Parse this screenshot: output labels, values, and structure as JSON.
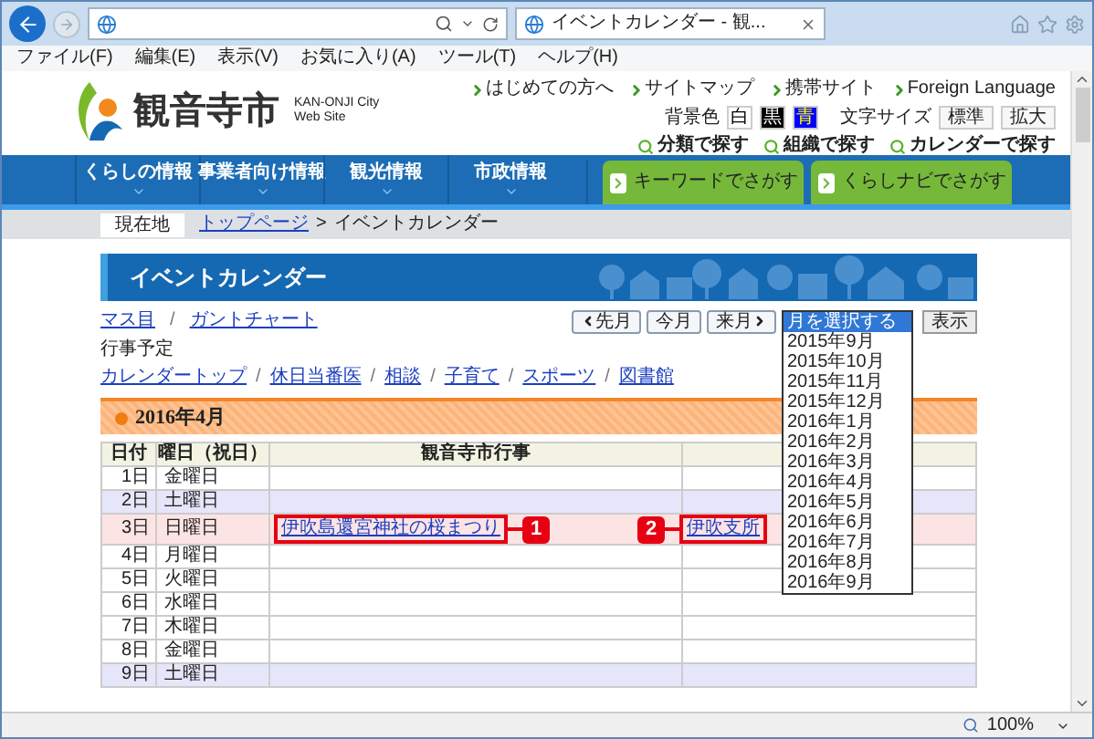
{
  "browser": {
    "tab_title": "イベントカレンダー - 観...",
    "menu": [
      "ファイル(F)",
      "編集(E)",
      "表示(V)",
      "お気に入り(A)",
      "ツール(T)",
      "ヘルプ(H)"
    ]
  },
  "header": {
    "logo_name": "観音寺市",
    "logo_subtitle_lines": [
      "KAN-ONJI City",
      "Web Site"
    ],
    "top_links": [
      "はじめての方へ",
      "サイトマップ",
      "携帯サイト",
      "Foreign Language"
    ],
    "background_color": {
      "label": "背景色",
      "options": [
        {
          "label": "白",
          "kind": "white"
        },
        {
          "label": "黒",
          "kind": "black"
        },
        {
          "label": "青",
          "kind": "blue"
        }
      ]
    },
    "text_size": {
      "label": "文字サイズ",
      "options": [
        "標準",
        "拡大"
      ]
    },
    "search_links": [
      "分類で探す",
      "組織で探す",
      "カレンダーで探す"
    ]
  },
  "nav": {
    "items": [
      "くらしの情報",
      "事業者向け情報",
      "観光情報",
      "市政情報"
    ],
    "search_tabs": [
      "キーワードでさがす",
      "くらしナビでさがす"
    ]
  },
  "breadcrumb": {
    "label": "現在地",
    "link": "トップページ",
    "separator": ">",
    "current": "イベントカレンダー"
  },
  "page_title": "イベントカレンダー",
  "view_links": [
    "マス目",
    "ガントチャート"
  ],
  "view_links_separator": "/",
  "month_nav": {
    "buttons": [
      {
        "label": "先月",
        "kind": "prev"
      },
      {
        "label": "今月",
        "kind": "plain"
      },
      {
        "label": "来月",
        "kind": "next"
      }
    ],
    "select": {
      "options": [
        {
          "label": "月を選択する",
          "selected": true
        },
        {
          "label": "2015年9月",
          "selected": false
        },
        {
          "label": "2015年10月",
          "selected": false
        },
        {
          "label": "2015年11月",
          "selected": false
        },
        {
          "label": "2015年12月",
          "selected": false
        },
        {
          "label": "2016年1月",
          "selected": false
        },
        {
          "label": "2016年2月",
          "selected": false
        },
        {
          "label": "2016年3月",
          "selected": false
        },
        {
          "label": "2016年4月",
          "selected": false
        },
        {
          "label": "2016年5月",
          "selected": false
        },
        {
          "label": "2016年6月",
          "selected": false
        },
        {
          "label": "2016年7月",
          "selected": false
        },
        {
          "label": "2016年8月",
          "selected": false
        },
        {
          "label": "2016年9月",
          "selected": false
        }
      ]
    },
    "show_button": "表示"
  },
  "section_label": "行事予定",
  "categories": [
    "カレンダートップ",
    "休日当番医",
    "相談",
    "子育て",
    "スポーツ",
    "図書館"
  ],
  "categories_separator": "/",
  "month_title": "2016年4月",
  "table": {
    "columns": [
      "日付",
      "曜日（祝日）",
      "観音寺市行事"
    ],
    "rows": [
      {
        "date": "1日",
        "weekday": "金曜日",
        "kind": "weekday"
      },
      {
        "date": "2日",
        "weekday": "土曜日",
        "kind": "saturday"
      },
      {
        "date": "3日",
        "weekday": "日曜日",
        "kind": "sunday",
        "event": {
          "text": "伊吹島還宮神社の桜まつり",
          "callout": "1"
        },
        "branch_event": {
          "text": "伊吹支所",
          "callout": "2"
        }
      },
      {
        "date": "4日",
        "weekday": "月曜日",
        "kind": "weekday"
      },
      {
        "date": "5日",
        "weekday": "火曜日",
        "kind": "weekday"
      },
      {
        "date": "6日",
        "weekday": "水曜日",
        "kind": "weekday"
      },
      {
        "date": "7日",
        "weekday": "木曜日",
        "kind": "weekday"
      },
      {
        "date": "8日",
        "weekday": "金曜日",
        "kind": "weekday"
      },
      {
        "date": "9日",
        "weekday": "土曜日",
        "kind": "saturday"
      }
    ]
  },
  "status_bar": {
    "zoom": "100%"
  }
}
